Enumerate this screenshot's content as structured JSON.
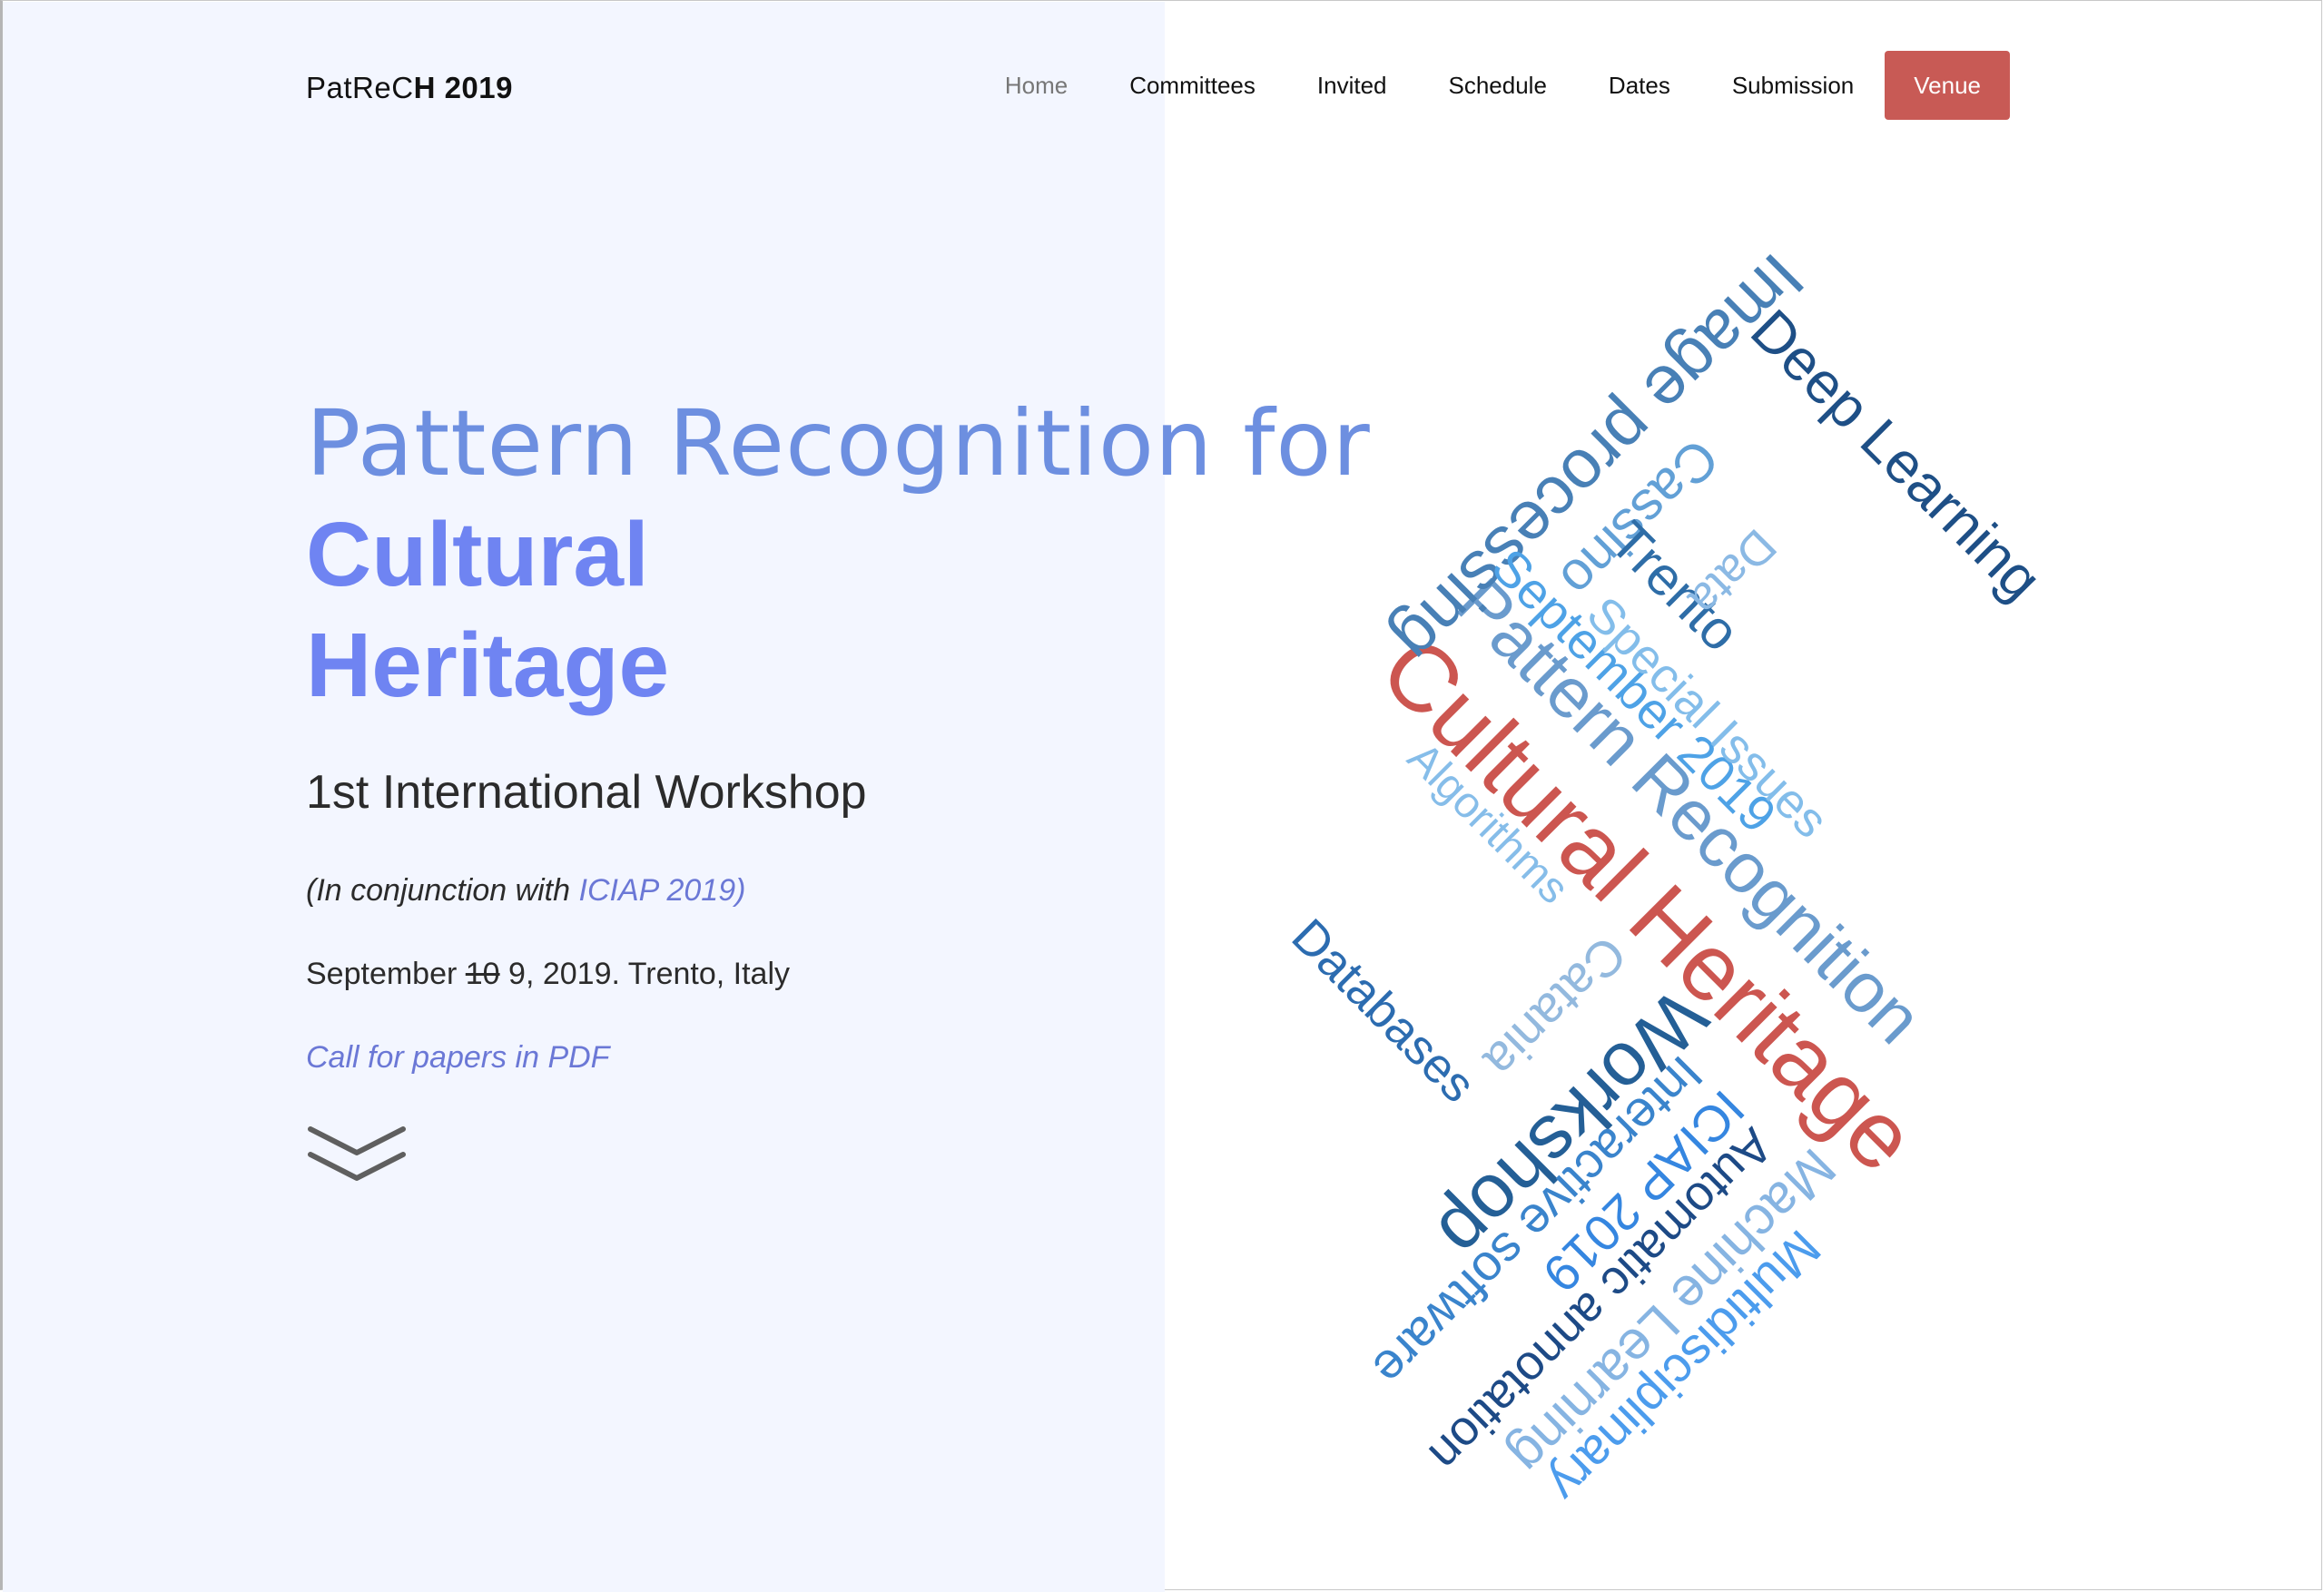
{
  "brand": {
    "light": "PatReC",
    "bold": "H 2019"
  },
  "nav": {
    "items": [
      {
        "label": "Home",
        "active": true
      },
      {
        "label": "Committees"
      },
      {
        "label": "Invited"
      },
      {
        "label": "Schedule"
      },
      {
        "label": "Dates"
      },
      {
        "label": "Submission"
      }
    ],
    "venue_label": "Venue"
  },
  "hero": {
    "title_light": "Pattern Recognition for",
    "title_bold_line1": "Cultural",
    "title_bold_line2": "Heritage",
    "subtitle": "1st International Workshop",
    "conjunction_prefix": "(In conjunction with ",
    "conjunction_link": "ICIAP 2019)",
    "date_prefix": "September ",
    "date_struck": "10",
    "date_rest": " 9, 2019. Trento, Italy",
    "cfp_link": "Call for papers in PDF"
  },
  "colors": {
    "accent_red": "#c85a55",
    "title_blue": "#6f84f2",
    "link_blue": "#6b78d6",
    "panel_bg": "#f3f6ff"
  },
  "wordcloud": {
    "words": [
      {
        "text": "Cultural Heritage",
        "color": "#cc5650"
      },
      {
        "text": "Pattern Recognition",
        "color": "#6a9bcd"
      },
      {
        "text": "Image processing",
        "color": "#4880b6"
      },
      {
        "text": "Deep Learning",
        "color": "#1e4f86"
      },
      {
        "text": "Workshop",
        "color": "#245f96"
      },
      {
        "text": "Cassino",
        "color": "#62a0d6"
      },
      {
        "text": "Trento",
        "color": "#2e6da7"
      },
      {
        "text": "Data",
        "color": "#8bb9e4"
      },
      {
        "text": "September 2019",
        "color": "#4ea2e6"
      },
      {
        "text": "Special Issues",
        "color": "#83bdea"
      },
      {
        "text": "Algorithms",
        "color": "#86bde9"
      },
      {
        "text": "Catania",
        "color": "#93b9de"
      },
      {
        "text": "Databases",
        "color": "#2c6cb0"
      },
      {
        "text": "Interactive software",
        "color": "#3a84cc"
      },
      {
        "text": "ICIAP 2019",
        "color": "#3586e0"
      },
      {
        "text": "Automatic annotation",
        "color": "#1d4a86"
      },
      {
        "text": "Machine Learning",
        "color": "#86b4e2"
      },
      {
        "text": "Multidisciplinary",
        "color": "#4c9ced"
      }
    ]
  }
}
